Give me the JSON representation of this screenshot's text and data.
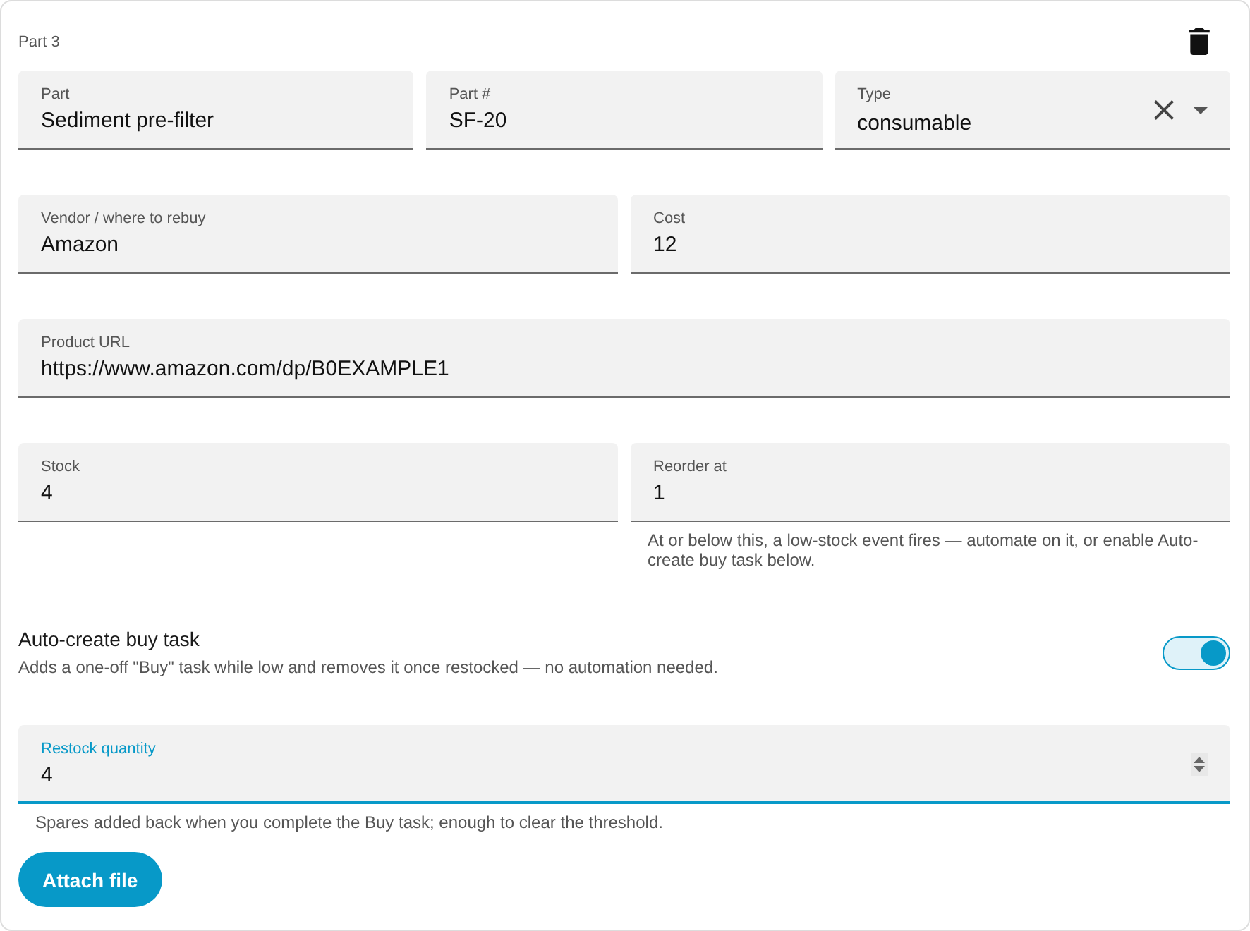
{
  "header": {
    "title": "Part 3"
  },
  "rows": [
    {
      "fields": [
        {
          "label": "Part",
          "value": "Sediment pre-filter",
          "kind": "text",
          "focused": false
        },
        {
          "label": "Part #",
          "value": "SF-20",
          "kind": "text",
          "focused": false
        },
        {
          "label": "Type",
          "value": "consumable",
          "kind": "select",
          "focused": false
        }
      ]
    },
    {
      "fields": [
        {
          "label": "Vendor / where to rebuy",
          "value": "Amazon",
          "kind": "text",
          "focused": false
        },
        {
          "label": "Cost",
          "value": "12",
          "kind": "number",
          "focused": false
        }
      ]
    },
    {
      "fields": [
        {
          "label": "Product URL",
          "value": "https://www.amazon.com/dp/B0EXAMPLE1",
          "kind": "text",
          "focused": false
        }
      ]
    },
    {
      "fields": [
        {
          "label": "Stock",
          "value": "4",
          "kind": "number",
          "focused": false
        },
        {
          "label": "Reorder at",
          "value": "1",
          "kind": "number",
          "focused": false,
          "helper": "At or below this, a low-stock event fires — automate on it, or enable Auto-create buy task below."
        }
      ]
    }
  ],
  "auto_buy": {
    "label": "Auto-create buy task",
    "description": "Adds a one-off \"Buy\" task while low and removes it once restocked — no automation needed.",
    "on": true
  },
  "restock": {
    "label": "Restock quantity",
    "value": "4",
    "kind": "number",
    "focused": true,
    "helper": "Spares added back when you complete the Buy task; enough to clear the threshold."
  },
  "actions": [
    {
      "label": "Attach file"
    }
  ]
}
